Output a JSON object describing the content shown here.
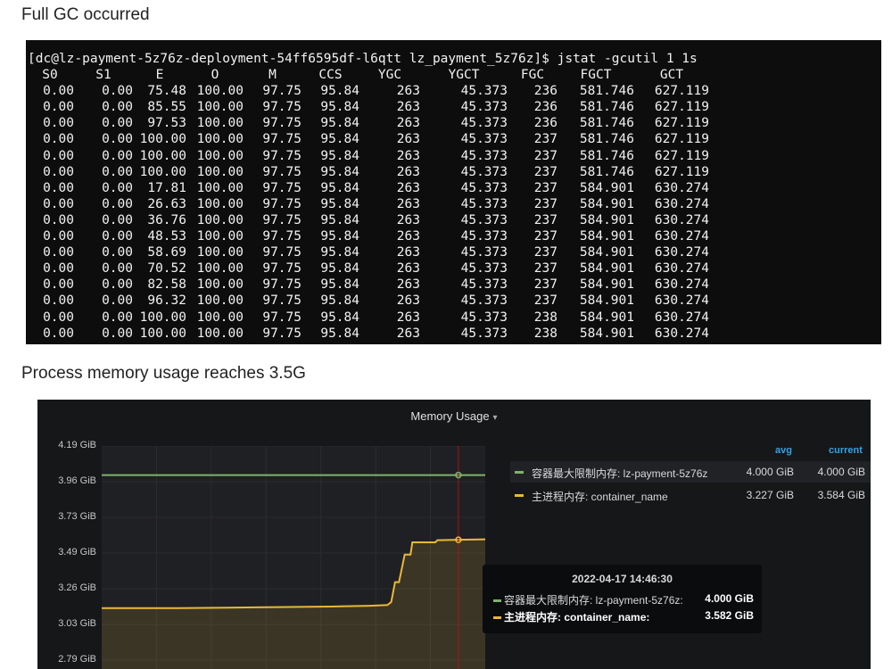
{
  "headings": {
    "gc": "Full GC occurred",
    "memory": "Process memory usage reaches 3.5G"
  },
  "terminal": {
    "prompt_line": "[dc@lz-payment-5z76z-deployment-54ff6595df-l6qtt lz_payment_5z76z]$ jstat -gcutil 1 1s",
    "columns": [
      "S0",
      "S1",
      "E",
      "O",
      "M",
      "CCS",
      "YGC",
      "YGCT",
      "FGC",
      "FGCT",
      "GCT"
    ],
    "rows": [
      [
        "0.00",
        "0.00",
        "75.48",
        "100.00",
        "97.75",
        "95.84",
        "263",
        "45.373",
        "236",
        "581.746",
        "627.119"
      ],
      [
        "0.00",
        "0.00",
        "85.55",
        "100.00",
        "97.75",
        "95.84",
        "263",
        "45.373",
        "236",
        "581.746",
        "627.119"
      ],
      [
        "0.00",
        "0.00",
        "97.53",
        "100.00",
        "97.75",
        "95.84",
        "263",
        "45.373",
        "236",
        "581.746",
        "627.119"
      ],
      [
        "0.00",
        "0.00",
        "100.00",
        "100.00",
        "97.75",
        "95.84",
        "263",
        "45.373",
        "237",
        "581.746",
        "627.119"
      ],
      [
        "0.00",
        "0.00",
        "100.00",
        "100.00",
        "97.75",
        "95.84",
        "263",
        "45.373",
        "237",
        "581.746",
        "627.119"
      ],
      [
        "0.00",
        "0.00",
        "100.00",
        "100.00",
        "97.75",
        "95.84",
        "263",
        "45.373",
        "237",
        "581.746",
        "627.119"
      ],
      [
        "0.00",
        "0.00",
        "17.81",
        "100.00",
        "97.75",
        "95.84",
        "263",
        "45.373",
        "237",
        "584.901",
        "630.274"
      ],
      [
        "0.00",
        "0.00",
        "26.63",
        "100.00",
        "97.75",
        "95.84",
        "263",
        "45.373",
        "237",
        "584.901",
        "630.274"
      ],
      [
        "0.00",
        "0.00",
        "36.76",
        "100.00",
        "97.75",
        "95.84",
        "263",
        "45.373",
        "237",
        "584.901",
        "630.274"
      ],
      [
        "0.00",
        "0.00",
        "48.53",
        "100.00",
        "97.75",
        "95.84",
        "263",
        "45.373",
        "237",
        "584.901",
        "630.274"
      ],
      [
        "0.00",
        "0.00",
        "58.69",
        "100.00",
        "97.75",
        "95.84",
        "263",
        "45.373",
        "237",
        "584.901",
        "630.274"
      ],
      [
        "0.00",
        "0.00",
        "70.52",
        "100.00",
        "97.75",
        "95.84",
        "263",
        "45.373",
        "237",
        "584.901",
        "630.274"
      ],
      [
        "0.00",
        "0.00",
        "82.58",
        "100.00",
        "97.75",
        "95.84",
        "263",
        "45.373",
        "237",
        "584.901",
        "630.274"
      ],
      [
        "0.00",
        "0.00",
        "96.32",
        "100.00",
        "97.75",
        "95.84",
        "263",
        "45.373",
        "237",
        "584.901",
        "630.274"
      ],
      [
        "0.00",
        "0.00",
        "100.00",
        "100.00",
        "97.75",
        "95.84",
        "263",
        "45.373",
        "238",
        "584.901",
        "630.274"
      ],
      [
        "0.00",
        "0.00",
        "100.00",
        "100.00",
        "97.75",
        "95.84",
        "263",
        "45.373",
        "238",
        "584.901",
        "630.274"
      ]
    ]
  },
  "grafana": {
    "panel_title": "Memory Usage",
    "legend": {
      "avg_label": "avg",
      "current_label": "current",
      "items": [
        {
          "name": "容器最大限制内存: lz-payment-5z76z",
          "avg": "4.000 GiB",
          "current": "4.000 GiB",
          "color": "#7eb26d"
        },
        {
          "name": "主进程内存: container_name",
          "avg": "3.227 GiB",
          "current": "3.584 GiB",
          "color": "#eab839"
        }
      ]
    },
    "tooltip": {
      "time": "2022-04-17 14:46:30",
      "rows": [
        {
          "label": "容器最大限制内存: lz-payment-5z76z:",
          "value": "4.000 GiB",
          "color": "#7eb26d"
        },
        {
          "label": "主进程内存: container_name:",
          "value": "3.582 GiB",
          "color": "#eab839"
        }
      ]
    }
  },
  "chart_data": {
    "type": "area",
    "title": "Memory Usage",
    "ytick_labels": [
      "4.19 GiB",
      "3.96 GiB",
      "3.73 GiB",
      "3.49 GiB",
      "3.26 GiB",
      "3.03 GiB",
      "2.79 GiB"
    ],
    "ylim": [
      2.79,
      4.19
    ],
    "xlim": [
      0,
      100
    ],
    "grid": true,
    "series": [
      {
        "name": "容器最大限制内存: lz-payment-5z76z",
        "color": "#7eb26d",
        "x": [
          0,
          100
        ],
        "y": [
          4.0,
          4.0
        ]
      },
      {
        "name": "主进程内存: container_name",
        "color": "#eab839",
        "x": [
          0,
          20,
          40,
          60,
          70,
          74.5,
          75.5,
          76.5,
          77.5,
          79,
          80.5,
          81,
          87,
          87.5,
          100
        ],
        "y": [
          3.13,
          3.13,
          3.135,
          3.14,
          3.145,
          3.15,
          3.17,
          3.3,
          3.3,
          3.48,
          3.48,
          3.56,
          3.56,
          3.574,
          3.58
        ]
      }
    ],
    "crosshair_x": 93
  }
}
